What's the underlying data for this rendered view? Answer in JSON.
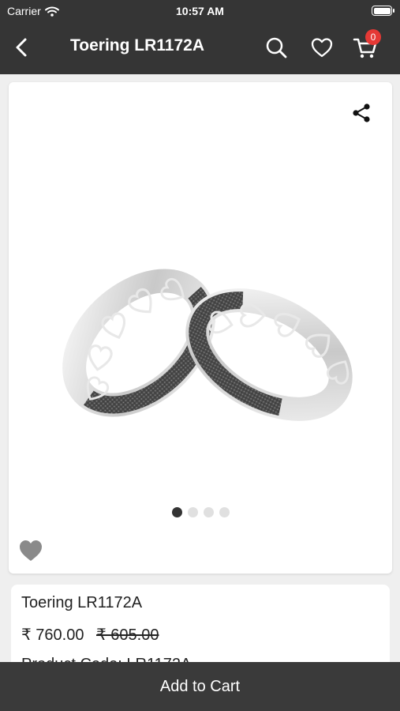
{
  "status_bar": {
    "carrier": "Carrier",
    "time": "10:57 AM",
    "wifi_icon": "wifi-icon",
    "battery_icon": "battery-icon"
  },
  "nav": {
    "title": "Toering LR1172A",
    "cart_count": "0",
    "icons": [
      "back-arrow-icon",
      "search-icon",
      "heart-icon",
      "cart-icon"
    ]
  },
  "gallery": {
    "dot_count": 4,
    "active_index": 0,
    "share_icon": "share-icon",
    "wishlist_icon": "heart-filled-icon"
  },
  "product": {
    "name": "Toering LR1172A",
    "price": "₹ 760.00",
    "mrp": "₹ 605.00",
    "code": "Product Code: LR1172A"
  },
  "footer": {
    "add_to_cart": "Add to Cart"
  },
  "colors": {
    "header": "#353535",
    "badge": "#e53935",
    "background": "#efefef",
    "footer": "#3a3a3a"
  }
}
